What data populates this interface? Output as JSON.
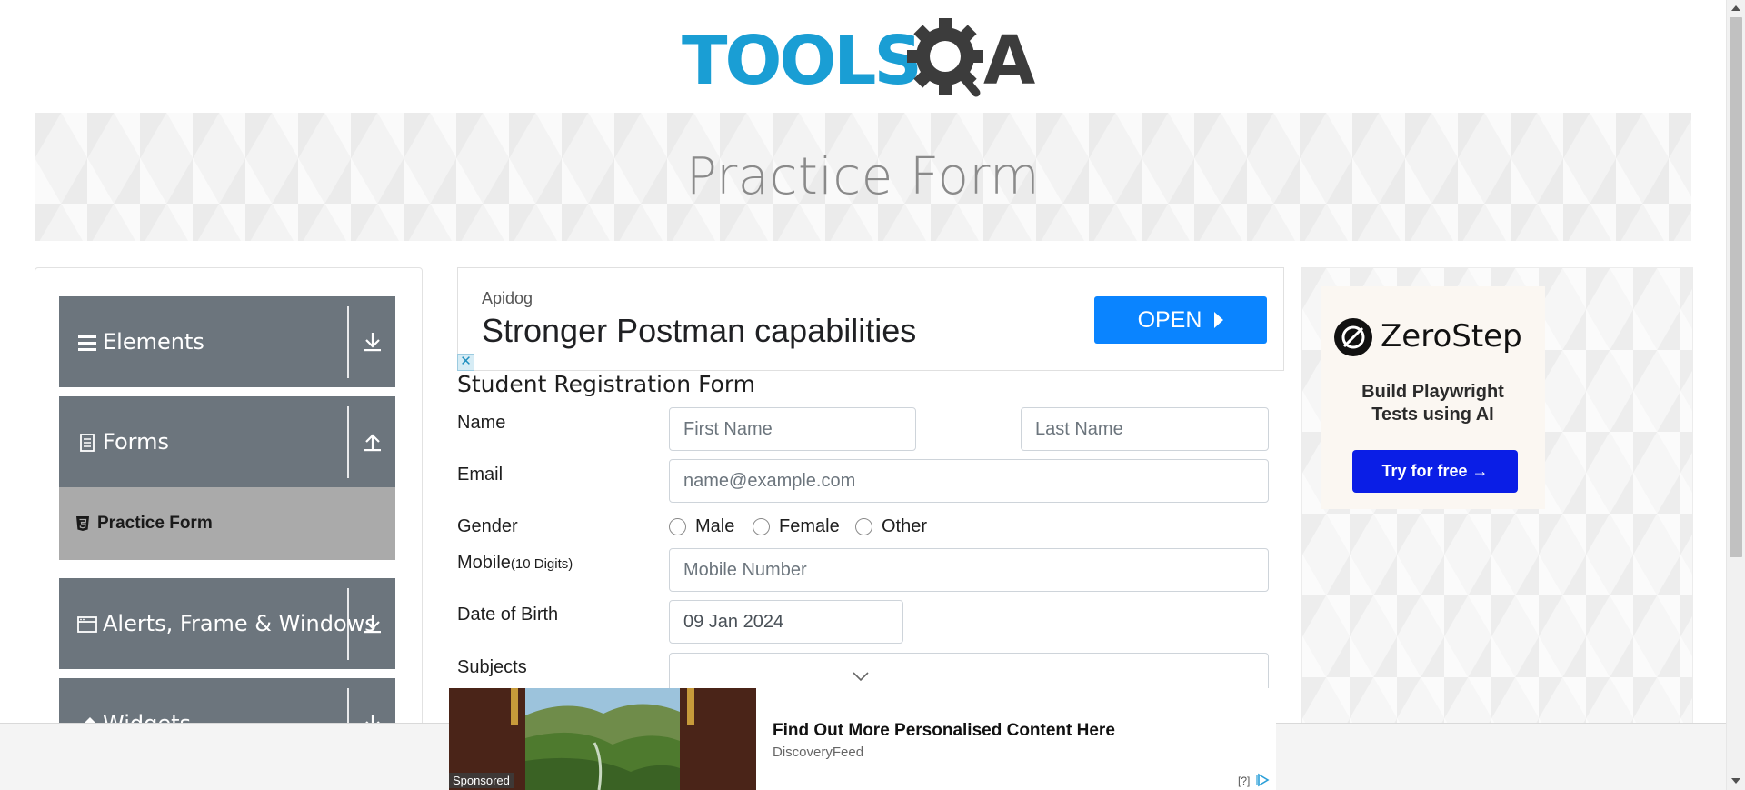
{
  "header": {
    "logo_text": "TOOLSQA",
    "logo_colors": {
      "tools": "#1a9ed4",
      "qa": "#3c3c3c"
    }
  },
  "banner": {
    "title": "Practice Form"
  },
  "sidebar": {
    "groups": [
      {
        "label": "Elements",
        "icon": "hamburger-icon",
        "arrow": "download-arrow-icon",
        "expanded": false
      },
      {
        "label": "Forms",
        "icon": "document-icon",
        "arrow": "upload-arrow-icon",
        "expanded": true
      },
      {
        "label": "Alerts, Frame & Windows",
        "icon": "window-icon",
        "arrow": "download-arrow-icon",
        "expanded": false
      },
      {
        "label": "Widgets",
        "icon": "widget-icon",
        "arrow": "download-arrow-icon",
        "expanded": false
      }
    ],
    "active_item": {
      "label": "Practice Form",
      "icon": "html5-icon"
    }
  },
  "top_ad": {
    "brand": "Apidog",
    "headline": "Stronger Postman capabilities",
    "cta": "OPEN",
    "close_glyph": "✕",
    "cta_color": "#0a84ff"
  },
  "form": {
    "title": "Student Registration Form",
    "name": {
      "label": "Name",
      "first_placeholder": "First Name",
      "last_placeholder": "Last Name"
    },
    "email": {
      "label": "Email",
      "placeholder": "name@example.com"
    },
    "gender": {
      "label": "Gender",
      "options": [
        "Male",
        "Female",
        "Other"
      ]
    },
    "mobile": {
      "label": "Mobile",
      "hint": "(10 Digits)",
      "placeholder": "Mobile Number"
    },
    "dob": {
      "label": "Date of Birth",
      "value": "09 Jan 2024"
    },
    "subjects": {
      "label": "Subjects"
    }
  },
  "right_ad": {
    "brand": "ZeroStep",
    "tagline_line1": "Build Playwright",
    "tagline_line2": "Tests using AI",
    "cta": "Try for free →",
    "cta_color": "#0a1ee6"
  },
  "bottom_ad": {
    "sponsored_label": "Sponsored",
    "headline": "Find Out More Personalised Content Here",
    "source": "DiscoveryFeed",
    "help": "[?]"
  }
}
